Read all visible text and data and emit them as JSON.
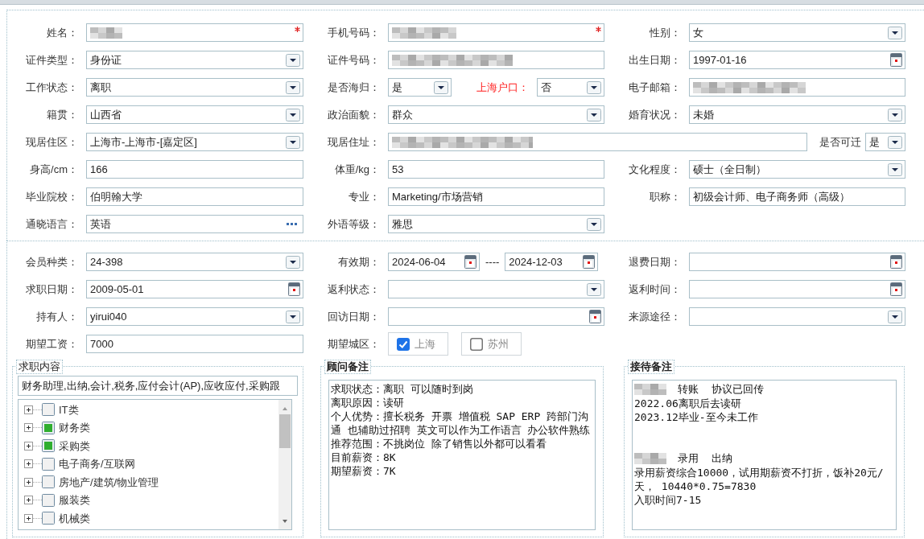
{
  "personal_rows": [
    {
      "kind": "standard",
      "fields": [
        {
          "label": "姓名：",
          "kind": "text",
          "value_hidden": true,
          "required": true,
          "highlight": false
        },
        {
          "label": "手机号码：",
          "kind": "text",
          "value_hidden": true,
          "required": true,
          "highlight": false
        },
        {
          "label": "性别：",
          "kind": "select",
          "value": "女",
          "required": false,
          "highlight": false
        }
      ]
    },
    {
      "kind": "standard",
      "fields": [
        {
          "label": "证件类型：",
          "kind": "select",
          "value": "身份证",
          "required": false,
          "highlight": false
        },
        {
          "label": "证件号码：",
          "kind": "text",
          "value_hidden": true,
          "required": false,
          "highlight": false
        },
        {
          "label": "出生日期：",
          "kind": "date",
          "value": "1997-01-16",
          "required": false,
          "highlight": false
        }
      ]
    },
    {
      "kind": "split_middle",
      "fields": [
        {
          "label": "工作状态：",
          "kind": "select",
          "value": "离职",
          "required": false,
          "highlight": false
        },
        {
          "label": "是否海归：",
          "kind": "select",
          "value": "是",
          "required": false,
          "highlight": false
        },
        {
          "label": "上海户口：",
          "kind": "select",
          "value": "否",
          "required": false,
          "highlight": true
        },
        {
          "label": "电子邮箱：",
          "kind": "text",
          "value_hidden": true,
          "required": false,
          "highlight": false
        }
      ]
    },
    {
      "kind": "standard",
      "fields": [
        {
          "label": "籍贯：",
          "kind": "select",
          "value": "山西省",
          "required": false,
          "highlight": false
        },
        {
          "label": "政治面貌：",
          "kind": "select",
          "value": "群众",
          "required": false,
          "highlight": false
        },
        {
          "label": "婚育状况：",
          "kind": "select",
          "value": "未婚",
          "required": false,
          "highlight": false
        }
      ]
    },
    {
      "kind": "wide_middle",
      "fields": [
        {
          "label": "现居住区：",
          "kind": "select",
          "value": "上海市-上海市-[嘉定区]",
          "required": false,
          "highlight": false
        },
        {
          "label": "现居住址：",
          "kind": "text",
          "value_hidden": true,
          "required": false,
          "highlight": false
        },
        {
          "label": "是否可迁",
          "kind": "select",
          "value": "是",
          "required": false,
          "highlight": false
        }
      ]
    },
    {
      "kind": "standard",
      "fields": [
        {
          "label": "身高/cm：",
          "kind": "text",
          "value": "166",
          "required": false,
          "highlight": false
        },
        {
          "label": "体重/kg：",
          "kind": "text",
          "value": "53",
          "required": false,
          "highlight": false
        },
        {
          "label": "文化程度：",
          "kind": "select",
          "value": "硕士（全日制）",
          "required": false,
          "highlight": false
        }
      ]
    },
    {
      "kind": "standard",
      "fields": [
        {
          "label": "毕业院校：",
          "kind": "text",
          "value": "伯明翰大学",
          "required": false,
          "highlight": false
        },
        {
          "label": "专业：",
          "kind": "text",
          "value": "Marketing/市场营销",
          "required": false,
          "highlight": false
        },
        {
          "label": "职称：",
          "kind": "text",
          "value": "初级会计师、电子商务师（高级）",
          "required": false,
          "highlight": false
        }
      ]
    },
    {
      "kind": "standard",
      "fields": [
        {
          "label": "通晓语言：",
          "kind": "lookup",
          "value": "英语",
          "required": false,
          "highlight": false
        },
        {
          "label": "外语等级：",
          "kind": "select",
          "value": "雅思",
          "required": false,
          "highlight": false
        }
      ]
    }
  ],
  "membership_rows": [
    {
      "kind": "standard",
      "fields": [
        {
          "label": "会员种类：",
          "kind": "select",
          "value": "24-398",
          "required": false,
          "highlight": false
        },
        {
          "label": "有效期：",
          "kind": "date_range",
          "values": [
            "2024-06-04",
            "2024-12-03"
          ],
          "separator": "----",
          "highlight": false
        },
        {
          "label": "退费日期：",
          "kind": "date",
          "required": false,
          "highlight": false
        }
      ]
    },
    {
      "kind": "standard",
      "fields": [
        {
          "label": "求职日期：",
          "kind": "date",
          "value": "2009-05-01",
          "required": false,
          "highlight": false
        },
        {
          "label": "返利状态：",
          "kind": "select",
          "required": false,
          "highlight": false
        },
        {
          "label": "返利时间：",
          "kind": "date",
          "required": false,
          "highlight": false
        }
      ]
    },
    {
      "kind": "standard",
      "fields": [
        {
          "label": "持有人：",
          "kind": "select",
          "value": "yirui040",
          "required": false,
          "highlight": false
        },
        {
          "label": "回访日期：",
          "kind": "date",
          "required": false,
          "highlight": false
        },
        {
          "label": "来源途径：",
          "kind": "select",
          "required": false,
          "highlight": false
        }
      ]
    },
    {
      "kind": "standard",
      "fields": [
        {
          "label": "期望工资：",
          "kind": "text",
          "value": "7000",
          "required": false,
          "highlight": false
        },
        {
          "label": "期望城区：",
          "kind": "checkboxes",
          "highlight": false,
          "options": [
            {
              "label": "上海",
              "checked": true,
              "disabled": true
            },
            {
              "label": "苏州",
              "checked": false,
              "disabled": true
            }
          ]
        }
      ]
    }
  ],
  "panels": [
    {
      "kind": "job_tree",
      "title": "求职内容",
      "bold": false,
      "summary": "财务助理,出纳,会计,税务,应付会计(AP),应收应付,采购跟",
      "items": [
        {
          "label": "IT类",
          "checked": false,
          "expanded": false
        },
        {
          "label": "财务类",
          "checked": true,
          "expanded": false
        },
        {
          "label": "采购类",
          "checked": true,
          "expanded": false
        },
        {
          "label": "电子商务/互联网",
          "checked": false,
          "expanded": false
        },
        {
          "label": "房地产/建筑/物业管理",
          "checked": false,
          "expanded": false
        },
        {
          "label": "服装类",
          "checked": false,
          "expanded": false
        },
        {
          "label": "机械类",
          "checked": false,
          "expanded": false
        }
      ]
    },
    {
      "kind": "notes",
      "title": "顾问备注",
      "bold": true,
      "blocks": [
        {
          "lines": [
            {
              "text": "求职状态：离职 可以随时到岗",
              "blurred_prefix": false
            },
            {
              "text": "离职原因：读研",
              "blurred_prefix": false
            },
            {
              "text": "个人优势：擅长税务 开票 增值税 SAP ERP 跨部门沟通 也辅助过招聘 英文可以作为工作语言 办公软件熟练",
              "blurred_prefix": false
            },
            {
              "text": "推荐范围：不挑岗位 除了销售以外都可以看看",
              "blurred_prefix": false
            },
            {
              "text": "目前薪资：8K",
              "blurred_prefix": false
            },
            {
              "text": "期望薪资：7K",
              "blurred_prefix": false
            }
          ]
        }
      ]
    },
    {
      "kind": "notes",
      "title": "接待备注",
      "bold": true,
      "blocks": [
        {
          "lines": [
            {
              "text": "转账  协议已回传",
              "blurred_prefix": true
            },
            {
              "text": "2022.06离职后去读研",
              "blurred_prefix": false
            },
            {
              "text": "2023.12毕业-至今未工作",
              "blurred_prefix": false
            }
          ]
        },
        {
          "lines": [
            {
              "text": "录用  出纳",
              "blurred_prefix": true
            },
            {
              "text": "录用薪资综合10000，试用期薪资不打折，饭补20元/天， 10440*0.75=7830",
              "blurred_prefix": false
            },
            {
              "text": "入职时间7-15",
              "blurred_prefix": false
            }
          ]
        }
      ]
    }
  ]
}
